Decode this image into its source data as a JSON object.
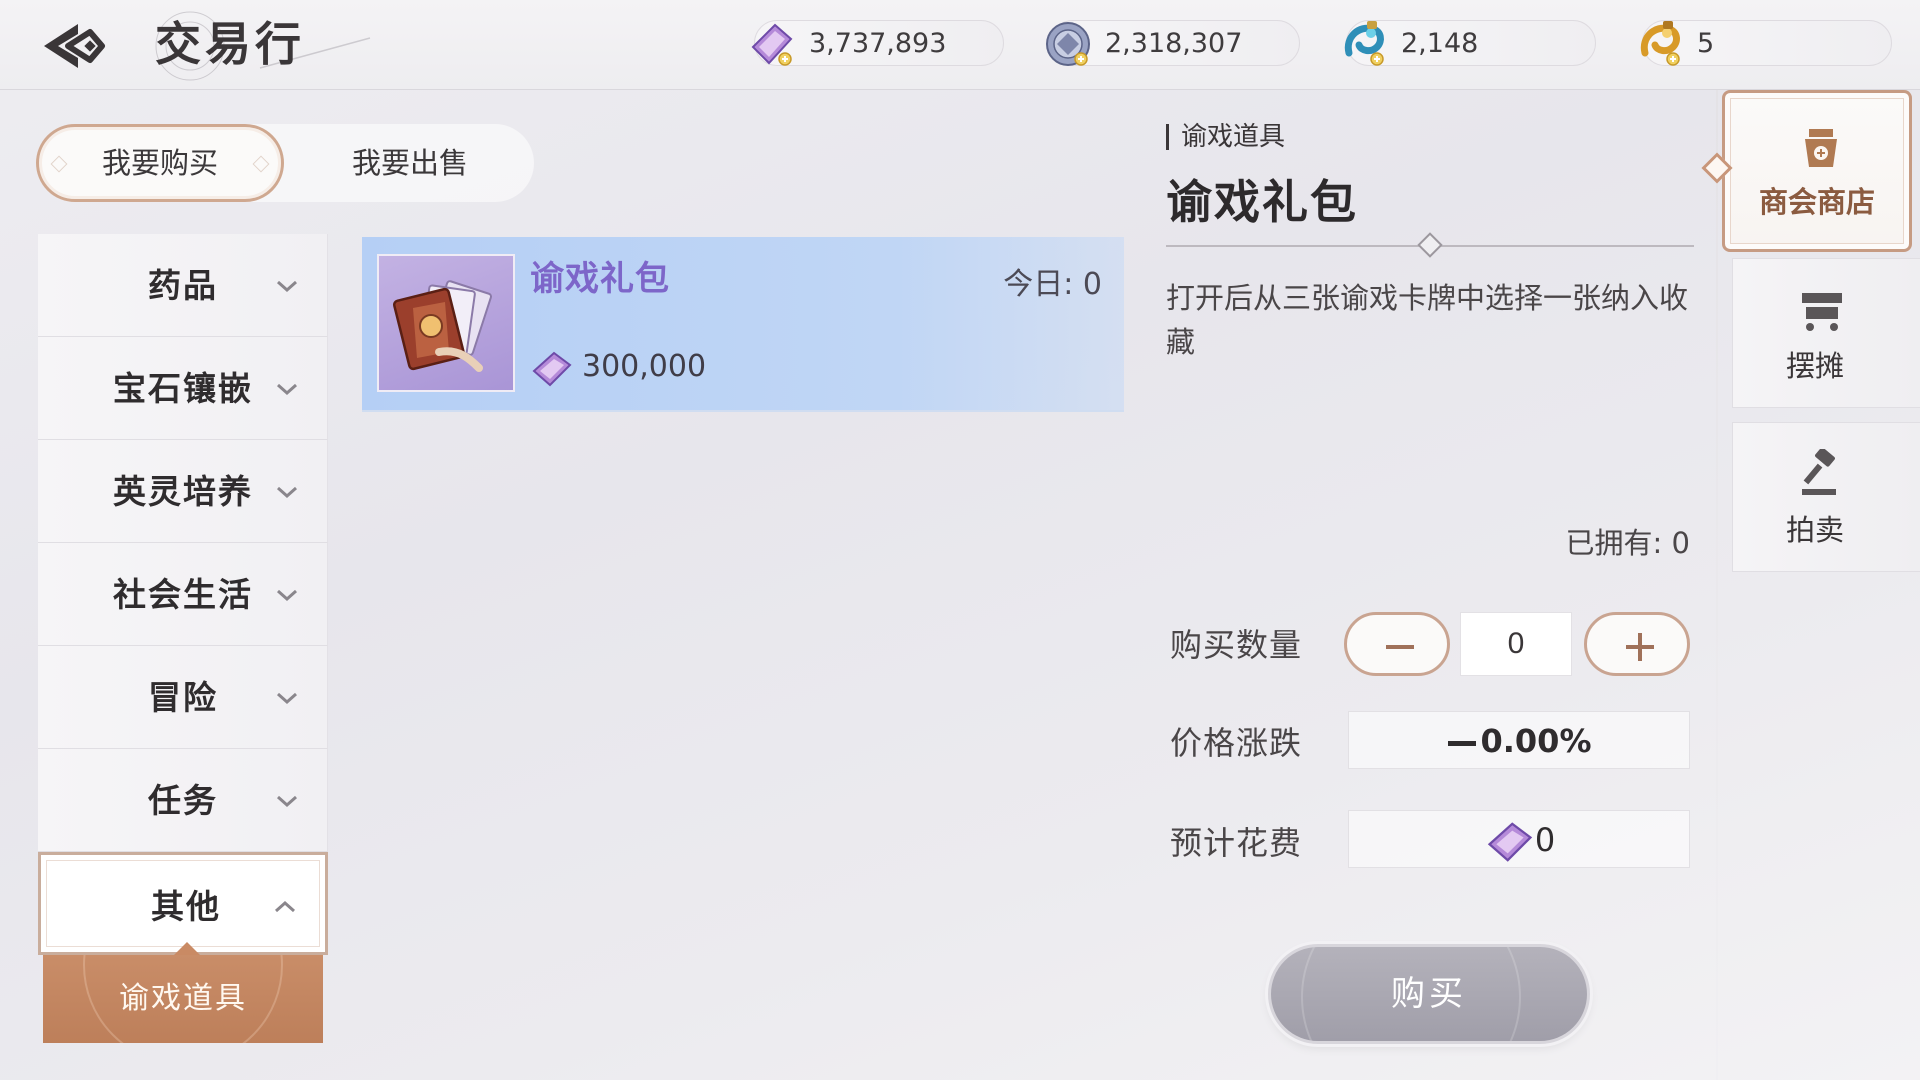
{
  "header": {
    "title": "交易行",
    "back_icon": "back-arrow-icon",
    "currencies": [
      {
        "name": "purple-crystal-icon",
        "value": "3,737,893"
      },
      {
        "name": "silver-coin-icon",
        "value": "2,318,307"
      },
      {
        "name": "blue-dragon-icon",
        "value": "2,148"
      },
      {
        "name": "gold-dragon-icon",
        "value": "5"
      }
    ]
  },
  "mode_tabs": {
    "buy": "我要购买",
    "sell": "我要出售",
    "active": "buy"
  },
  "categories": [
    {
      "label": "药品",
      "expanded": false
    },
    {
      "label": "宝石镶嵌",
      "expanded": false
    },
    {
      "label": "英灵培养",
      "expanded": false
    },
    {
      "label": "社会生活",
      "expanded": false
    },
    {
      "label": "冒险",
      "expanded": false
    },
    {
      "label": "任务",
      "expanded": false
    },
    {
      "label": "其他",
      "expanded": true
    }
  ],
  "subcategory": {
    "label": "谕戏道具",
    "selected": true
  },
  "item_list": [
    {
      "name": "谕戏礼包",
      "today": "今日: 0",
      "price": "300,000",
      "price_icon": "purple-crystal-icon",
      "selected": true
    }
  ],
  "detail": {
    "category": "谕戏道具",
    "title": "谕戏礼包",
    "description": "打开后从三张谕戏卡牌中选择一张纳入收藏",
    "owned": "已拥有: 0",
    "quantity_label": "购买数量",
    "quantity": "0",
    "price_change_label": "价格涨跌",
    "price_change": "0.00%",
    "cost_label": "预计花费",
    "cost": "0",
    "buy_label": "购买"
  },
  "side_nav": [
    {
      "label": "商会商店",
      "icon": "merchant-shop-icon",
      "active": true
    },
    {
      "label": "摆摊",
      "icon": "stall-cart-icon",
      "active": false
    },
    {
      "label": "拍卖",
      "icon": "auction-gavel-icon",
      "active": false
    }
  ],
  "colors": {
    "accent_bronze": "#c9a491",
    "selected_row": "#b5cff5",
    "item_name": "#7d66c9",
    "subcategory_bg": "#c98d68"
  }
}
